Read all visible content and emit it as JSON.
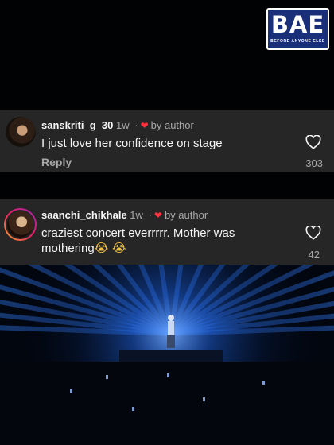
{
  "brand": {
    "word": "BAE",
    "tagline": "BEFORE ANYONE ELSE"
  },
  "comments": [
    {
      "username": "sanskriti_g_30",
      "time": "1w",
      "liked_by": "by author",
      "text": "I just love her confidence on stage",
      "reply_label": "Reply",
      "likes": "303"
    },
    {
      "username": "saanchi_chikhale",
      "time": "1w",
      "liked_by": "by author",
      "text": "craziest concert everrrrr. Mother was mothering",
      "emoji": "😭 😭",
      "likes": "42"
    }
  ],
  "colors": {
    "card_bg": "#262626",
    "heart_red": "#ff3040",
    "stage_blue": "#1f5fd6"
  },
  "icons": {
    "like": "heart-outline-icon",
    "author_like": "heart-filled-icon"
  }
}
